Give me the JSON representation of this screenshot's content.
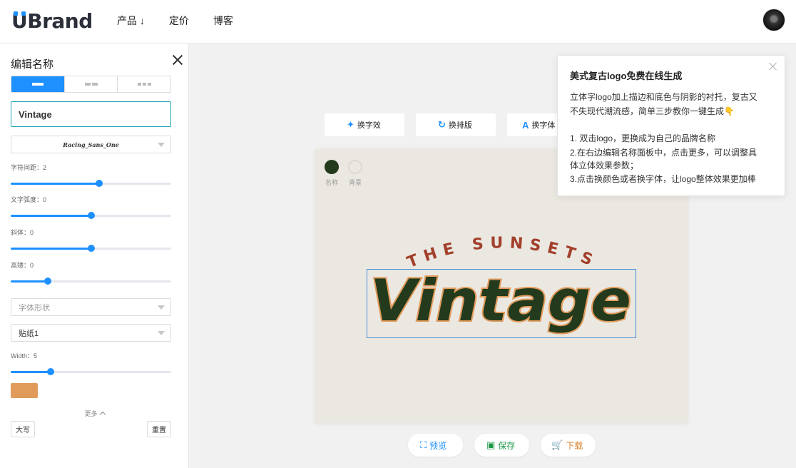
{
  "brand": {
    "name_u": "U",
    "name_rest": "Brand"
  },
  "nav": {
    "products": "产品 ↓",
    "pricing": "定价",
    "blog": "博客"
  },
  "left_panel": {
    "title": "编辑名称",
    "text_value": "Vintage",
    "font_name": "Racing_Sans_One",
    "letter_spacing_label": "字符间距：2",
    "arc_label": "文字弧度：0",
    "italic_label": "斜体：0",
    "height_label": "高矮：0",
    "shape_placeholder": "字体形状",
    "sticker_value": "贴纸1",
    "width_label": "Width：5",
    "stroke_color": "#e09b5b",
    "more_label": "更多",
    "uppercase_button": "大写",
    "reset_button": "重置"
  },
  "sliders": {
    "letter_spacing": 0.55,
    "arc": 0.5,
    "italic": 0.5,
    "height": 0.23,
    "width": 0.25
  },
  "toolbar": {
    "effect": "换字效",
    "layout": "换排版",
    "font": "换字体"
  },
  "canvas": {
    "name_label": "名称",
    "bg_label": "背景",
    "name_color": "#233a1c",
    "bg_color": "#ebe8e1",
    "logo_arc_text": "THE SUNSETS",
    "logo_main_text": "Vintage",
    "arc_color": "#a23f2b",
    "main_fill": "#233a1c",
    "main_stroke": "#e09b5b"
  },
  "bottom": {
    "preview": "预览",
    "save": "保存",
    "download": "下载"
  },
  "popup": {
    "title": "美式复古logo免费在线生成",
    "line1": "立体字logo加上描边和底色与阴影的衬托，复古又",
    "line2": "不失现代潮流感，简单三步教你一键生成👇",
    "step1": "1. 双击logo，更换成为自己的品牌名称",
    "step2a": "2.在右边编辑名称面板中，点击更多，可以调整具",
    "step2b": "体立体效果参数；",
    "step3": "3.点击换颜色或者换字体，让logo整体效果更加棒"
  }
}
